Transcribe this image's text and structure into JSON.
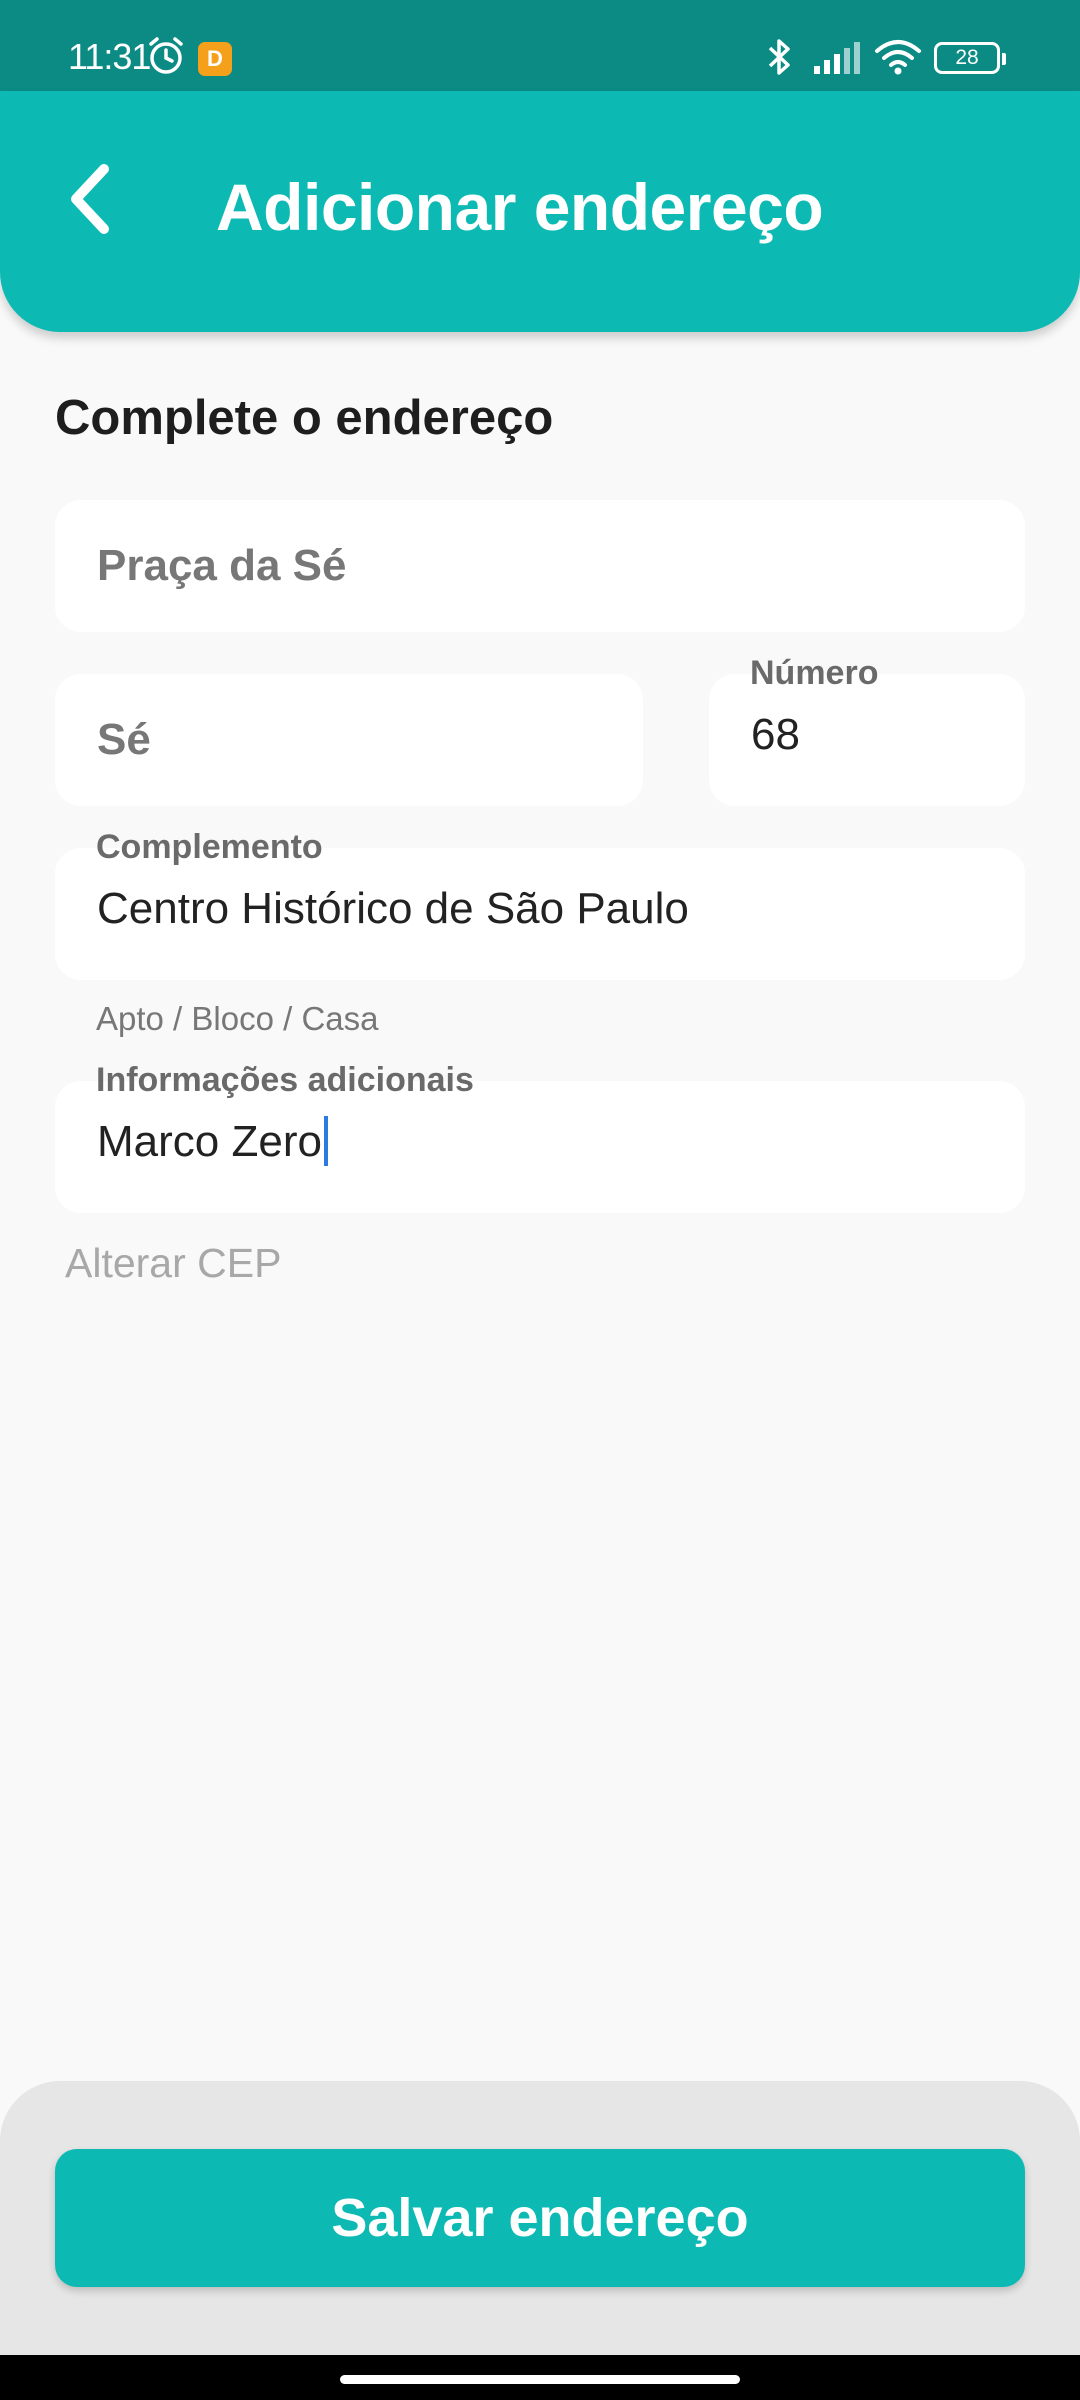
{
  "status_bar": {
    "time": "11:31",
    "app_badge": "D",
    "battery": "28",
    "icons": [
      "alarm-icon",
      "bluetooth-icon",
      "signal-icon",
      "wifi-icon",
      "battery-icon"
    ]
  },
  "header": {
    "title": "Adicionar endereço",
    "back_icon": "chevron-left-icon"
  },
  "form": {
    "section_title": "Complete o endereço",
    "street": {
      "value": "Praça da Sé"
    },
    "neighborhood": {
      "value": "Sé"
    },
    "number": {
      "label": "Número",
      "value": "68"
    },
    "complement": {
      "label": "Complemento",
      "value": "Centro Histórico de São Paulo",
      "helper": "Apto / Bloco / Casa"
    },
    "additional_info": {
      "label": "Informações adicionais",
      "value": "Marco Zero"
    },
    "change_cep": "Alterar CEP"
  },
  "footer": {
    "save_label": "Salvar endereço"
  },
  "colors": {
    "primary": "#0dbab3",
    "status_bar": "#0c8b85",
    "caret": "#2b7be0"
  }
}
